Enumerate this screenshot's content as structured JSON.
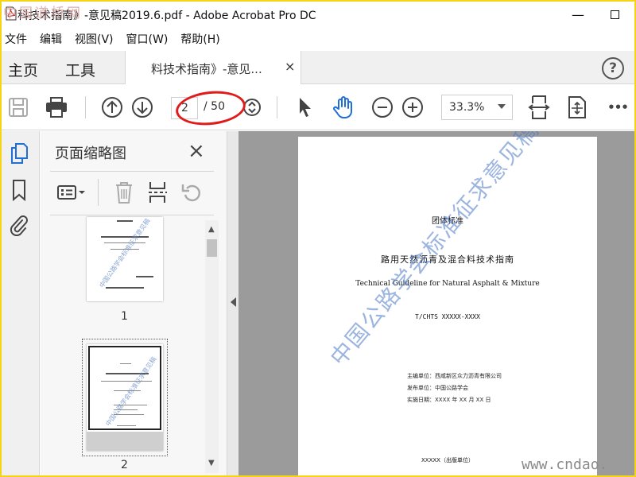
{
  "window": {
    "title": "科技术指南》-意见稿2019.6.pdf - Adobe Acrobat Pro DC",
    "minimize": "—",
    "logo_watermark": "中国道桥网"
  },
  "menu": [
    "文件",
    "编辑",
    "视图(V)",
    "窗口(W)",
    "帮助(H)"
  ],
  "tabs": {
    "home": "主页",
    "tools": "工具",
    "doc_tab_label": "料技术指南》-意见...",
    "close": "×",
    "help": "?"
  },
  "toolbar": {
    "current_page": "2",
    "total_pages": "/ 50",
    "zoom": "33.3%",
    "more": "•••",
    "colors": {
      "annotation_ellipse": "#e01b1b",
      "hand_tool": "#1f6fd6"
    }
  },
  "thumbnails_panel": {
    "title": "页面缩略图",
    "close": "×",
    "pages": [
      {
        "number": "1"
      },
      {
        "number": "2"
      }
    ]
  },
  "document": {
    "org": "团体标准",
    "title": "路用天然沥青及混合料技术指南",
    "title_en": "Technical Guideline for Natural Asphalt & Mixture",
    "code": "T/CHTS XXXXX-XXXX",
    "editor": "主编单位：西咸新区众力沥青有限公司",
    "issuer": "发布单位：中国公路学会",
    "date": "实施日期：XXXX 年 XX 月 XX 日",
    "publisher": "XXXXX（出版单位）",
    "watermark": "中国公路学会标准征求意见稿"
  },
  "site_watermark": "www.cndao."
}
